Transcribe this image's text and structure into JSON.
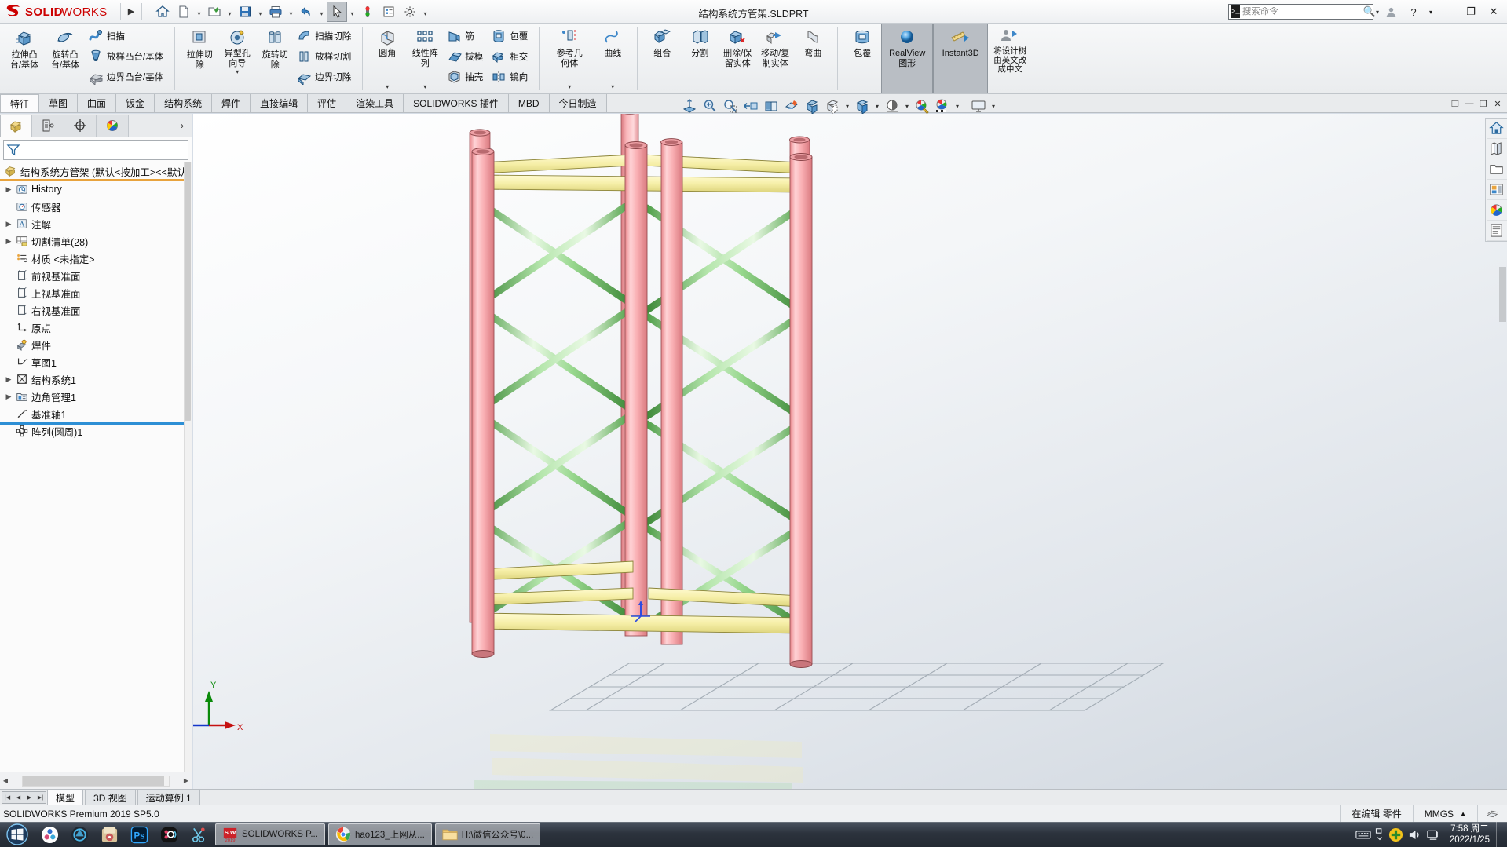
{
  "window": {
    "doc_title": "结构系统方管架.SLDPRT",
    "search_placeholder": "搜索命令",
    "minimize_label": "—",
    "restore_label": "❐",
    "close_label": "✕",
    "help_label": "?"
  },
  "quickbar": {
    "items": [
      {
        "name": "home-icon",
        "label": "主页"
      },
      {
        "name": "new-document-icon",
        "label": "新建"
      },
      {
        "name": "open-folder-icon",
        "label": "打开"
      },
      {
        "name": "save-icon",
        "label": "保存"
      },
      {
        "name": "print-icon",
        "label": "打印"
      },
      {
        "name": "undo-icon",
        "label": "撤销"
      },
      {
        "name": "select-cursor-icon",
        "label": "选择"
      },
      {
        "name": "rebuild-icon",
        "label": "重建模型"
      },
      {
        "name": "options-list-icon",
        "label": "选项列表"
      },
      {
        "name": "gear-icon",
        "label": "选项"
      }
    ]
  },
  "ribbon": {
    "groups": [
      {
        "name": "boss-base",
        "big": [
          {
            "label": "拉伸凸\n台/基体",
            "icon": "extrude-boss-icon"
          },
          {
            "label": "旋转凸\n台/基体",
            "icon": "revolve-boss-icon"
          }
        ],
        "small": [
          {
            "label": "扫描",
            "icon": "sweep-icon"
          },
          {
            "label": "放样凸台/基体",
            "icon": "loft-boss-icon"
          },
          {
            "label": "边界凸台/基体",
            "icon": "boundary-boss-icon"
          }
        ]
      },
      {
        "name": "cut",
        "big": [
          {
            "label": "拉伸切\n除",
            "icon": "extrude-cut-icon"
          },
          {
            "label": "异型孔\n向导",
            "icon": "hole-wizard-icon",
            "caret": true
          },
          {
            "label": "旋转切\n除",
            "icon": "revolve-cut-icon"
          }
        ],
        "small": [
          {
            "label": "扫描切除",
            "icon": "sweep-cut-icon"
          },
          {
            "label": "放样切割",
            "icon": "loft-cut-icon"
          },
          {
            "label": "边界切除",
            "icon": "boundary-cut-icon"
          }
        ]
      },
      {
        "name": "features",
        "big": [
          {
            "label": "圆角",
            "icon": "fillet-icon",
            "caret": true
          },
          {
            "label": "线性阵\n列",
            "icon": "linear-pattern-icon",
            "caret": true
          }
        ],
        "small": [
          {
            "label": "筋",
            "icon": "rib-icon"
          },
          {
            "label": "拔模",
            "icon": "draft-icon"
          },
          {
            "label": "抽壳",
            "icon": "shell-icon"
          }
        ],
        "small2": [
          {
            "label": "包覆",
            "icon": "wrap-icon"
          },
          {
            "label": "相交",
            "icon": "intersect-icon"
          },
          {
            "label": "镜向",
            "icon": "mirror-icon"
          }
        ]
      },
      {
        "name": "reference",
        "big": [
          {
            "label": "参考几\n何体",
            "icon": "reference-geometry-icon",
            "caret": true
          },
          {
            "label": "曲线",
            "icon": "curves-icon",
            "caret": true
          }
        ]
      },
      {
        "name": "bodies",
        "big": [
          {
            "label": "组合",
            "icon": "combine-icon"
          },
          {
            "label": "分割",
            "icon": "split-icon"
          },
          {
            "label": "删除/保\n留实体",
            "icon": "delete-keep-body-icon"
          },
          {
            "label": "移动/复\n制实体",
            "icon": "move-copy-body-icon"
          },
          {
            "label": "弯曲",
            "icon": "flex-icon"
          }
        ]
      },
      {
        "name": "display",
        "big": [
          {
            "label": "包覆",
            "icon": "wrap2-icon"
          },
          {
            "label": "RealView\n图形",
            "icon": "realview-icon",
            "selected": true
          },
          {
            "label": "Instant3D",
            "icon": "instant3d-icon",
            "selected": true
          },
          {
            "label": "将设计树\n由英文改\n成中文",
            "icon": "translate-tree-icon"
          }
        ]
      }
    ]
  },
  "command_tabs": [
    {
      "label": "特征",
      "active": true
    },
    {
      "label": "草图",
      "active": false
    },
    {
      "label": "曲面",
      "active": false
    },
    {
      "label": "钣金",
      "active": false
    },
    {
      "label": "结构系统",
      "active": false
    },
    {
      "label": "焊件",
      "active": false
    },
    {
      "label": "直接编辑",
      "active": false
    },
    {
      "label": "评估",
      "active": false
    },
    {
      "label": "渲染工具",
      "active": false
    },
    {
      "label": "SOLIDWORKS 插件",
      "active": false
    },
    {
      "label": "MBD",
      "active": false
    },
    {
      "label": "今日制造",
      "active": false
    }
  ],
  "view_toolbar": {
    "items": [
      {
        "name": "zoom-to-fit-icon",
        "label": "整屏显示全图"
      },
      {
        "name": "zoom-to-area-icon",
        "label": "局部放大"
      },
      {
        "name": "previous-view-icon",
        "label": "上一视图"
      },
      {
        "name": "section-view-icon",
        "label": "剖面视图"
      },
      {
        "name": "view-orientation-icon",
        "label": "视图定向"
      },
      {
        "name": "display-style-icon",
        "label": "显示样式"
      },
      {
        "name": "hide-show-items-icon",
        "label": "隐藏/显示项目"
      },
      {
        "name": "edit-appearance-icon",
        "label": "编辑外观"
      },
      {
        "name": "apply-scene-icon",
        "label": "应用布景"
      },
      {
        "name": "view-settings-icon",
        "label": "视图设定"
      }
    ]
  },
  "feature_tree": {
    "tabs": [
      {
        "name": "feature-manager-tab",
        "label": "FeatureManager 设计树",
        "active": true
      },
      {
        "name": "property-manager-tab",
        "label": "PropertyManager",
        "active": false
      },
      {
        "name": "configuration-manager-tab",
        "label": "ConfigurationManager",
        "active": false
      },
      {
        "name": "display-manager-tab",
        "label": "DisplayManager",
        "active": false
      }
    ],
    "filter_placeholder": "",
    "root": "结构系统方管架  (默认<按加工><<默认",
    "items": [
      {
        "label": "History",
        "icon": "history-icon",
        "expandable": true,
        "indent": 0
      },
      {
        "label": "传感器",
        "icon": "sensor-icon",
        "expandable": false,
        "indent": 0
      },
      {
        "label": "注解",
        "icon": "annotations-icon",
        "expandable": true,
        "indent": 0
      },
      {
        "label": "切割清单(28)",
        "icon": "cut-list-icon",
        "expandable": true,
        "indent": 0
      },
      {
        "label": "材质 <未指定>",
        "icon": "material-icon",
        "expandable": false,
        "indent": 0
      },
      {
        "label": "前视基准面",
        "icon": "plane-icon",
        "expandable": false,
        "indent": 0
      },
      {
        "label": "上视基准面",
        "icon": "plane-icon",
        "expandable": false,
        "indent": 0
      },
      {
        "label": "右视基准面",
        "icon": "plane-icon",
        "expandable": false,
        "indent": 0
      },
      {
        "label": "原点",
        "icon": "origin-icon",
        "expandable": false,
        "indent": 0
      },
      {
        "label": "焊件",
        "icon": "weldment-icon",
        "expandable": false,
        "indent": 0
      },
      {
        "label": "草图1",
        "icon": "sketch-icon",
        "expandable": false,
        "indent": 0
      },
      {
        "label": "结构系统1",
        "icon": "structure-system-icon",
        "expandable": true,
        "indent": 0
      },
      {
        "label": "边角管理1",
        "icon": "corner-management-icon",
        "expandable": true,
        "indent": 0
      },
      {
        "label": "基准轴1",
        "icon": "axis-icon",
        "expandable": false,
        "indent": 0
      },
      {
        "label": "阵列(圆周)1",
        "icon": "circular-pattern-icon",
        "expandable": false,
        "indent": 0
      }
    ]
  },
  "right_toolbar": {
    "items": [
      {
        "name": "task-pane-home-icon",
        "label": "SOLIDWORKS 资源"
      },
      {
        "name": "design-library-icon",
        "label": "设计库"
      },
      {
        "name": "file-explorer-icon",
        "label": "文件探索器"
      },
      {
        "name": "view-palette-icon",
        "label": "视图调色板"
      },
      {
        "name": "appearances-scenes-icon",
        "label": "外观、布景和贴图"
      },
      {
        "name": "custom-properties-icon",
        "label": "自定义属性"
      }
    ]
  },
  "bottom_tabs": [
    {
      "label": "模型",
      "active": true
    },
    {
      "label": "3D 视图",
      "active": false
    },
    {
      "label": "运动算例 1",
      "active": false
    }
  ],
  "status_bar": {
    "left": "SOLIDWORKS Premium 2019 SP5.0",
    "editing": "在编辑 零件",
    "units": "MMGS"
  },
  "taskbar": {
    "pinned": [
      {
        "name": "taskbar-icon-browser-1",
        "label": "浏览器"
      },
      {
        "name": "taskbar-icon-camera",
        "label": "相机"
      },
      {
        "name": "taskbar-icon-folder-app",
        "label": "文件应用"
      },
      {
        "name": "taskbar-icon-photoshop",
        "label": "Ps"
      },
      {
        "name": "taskbar-icon-media",
        "label": "媒体"
      },
      {
        "name": "taskbar-icon-snip",
        "label": "截图工具"
      }
    ],
    "tasks": [
      {
        "name": "taskbar-task-solidworks",
        "label": "SOLIDWORKS P...",
        "icon": "sw-2019-icon"
      },
      {
        "name": "taskbar-task-browser",
        "label": "hao123_上网从...",
        "icon": "chrome-icon"
      },
      {
        "name": "taskbar-task-explorer",
        "label": "H:\\微信公众号\\0...",
        "icon": "folder-icon"
      }
    ],
    "tray": [
      {
        "name": "tray-keyboard-icon",
        "label": "输入法"
      },
      {
        "name": "tray-expand-icon",
        "label": "显示隐藏的图标"
      },
      {
        "name": "tray-security-icon",
        "label": "安全"
      },
      {
        "name": "tray-volume-icon",
        "label": "音量"
      },
      {
        "name": "tray-network-icon",
        "label": "网络"
      }
    ],
    "clock_time": "7:58 周二",
    "clock_date": "2022/1/25"
  },
  "model": {
    "name": "方管架结构系统",
    "colors": {
      "column": "#f7a9ac",
      "column_dark": "#e08c90",
      "beam": "#f7f0b0",
      "beam_dark": "#ded77f",
      "brace": "#a8e0a0",
      "brace_dark": "#5fa857",
      "background_top": "#ffffff",
      "background_bottom": "#cfd6de"
    }
  }
}
